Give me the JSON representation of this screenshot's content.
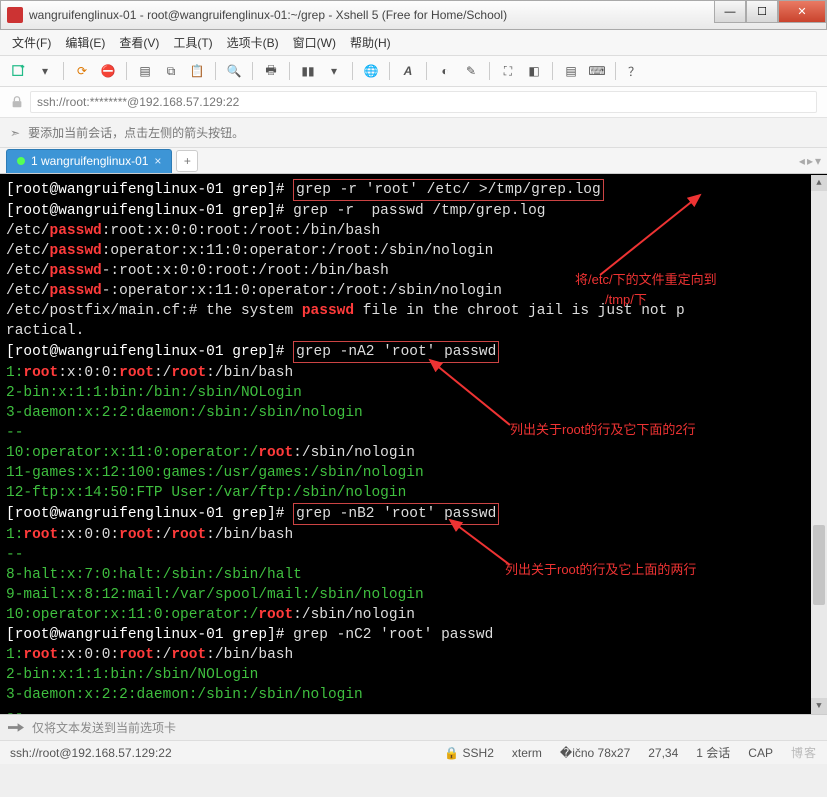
{
  "window": {
    "title": "wangruifenglinux-01 - root@wangruifenglinux-01:~/grep - Xshell 5 (Free for Home/School)"
  },
  "menu": {
    "file": "文件(F)",
    "edit": "编辑(E)",
    "view": "查看(V)",
    "tools": "工具(T)",
    "tabs": "选项卡(B)",
    "window": "窗口(W)",
    "help": "帮助(H)"
  },
  "address": {
    "text": "ssh://root:********@192.168.57.129:22"
  },
  "hint": {
    "text": "要添加当前会话，点击左侧的箭头按钮。"
  },
  "tab": {
    "label": "1 wangruifenglinux-01",
    "close": "×",
    "add": "+"
  },
  "terminal": {
    "prompt": "[root@wangruifenglinux-01 grep]#",
    "cmd1_box": "grep -r 'root' /etc/ >/tmp/grep.log",
    "cmd2": " grep -r  passwd /tmp/grep.log",
    "l1_a": "/etc/",
    "l1_pw": "passwd",
    "l1_b": ":root:x:0:0:root:/root:/bin/bash",
    "l2_a": "/etc/",
    "l2_b": ":operator:x:11:0:operator:/root:/sbin/nologin",
    "l3_a": "/etc/",
    "l3_b": "-:root:x:0:0:root:/root:/bin/bash",
    "l4_a": "/etc/",
    "l4_b": "-:operator:x:11:0:operator:/root:/sbin/nologin",
    "l5_a": "/etc/postfix/main.cf:# the system ",
    "l5_pw": "passwd",
    "l5_b": " file in the chroot jail is just not p",
    "l5_c": "ractical.",
    "cmd3_box": "grep -nA2 'root' passwd",
    "r1_n": "1",
    "r1_a": ":",
    "r1_root": "root",
    "r1_b": ":x:0:0:",
    "r1_c": ":/",
    "r1_d": ":/bin/bash",
    "r2_n": "2",
    "r2_a": "-bin:x:1:1:bin:/bin:/sbin/NOLogin",
    "r3_n": "3",
    "r3_a": "-daemon:x:2:2:daemon:/sbin:/sbin/nologin",
    "dash": "--",
    "r4_n": "10",
    "r4_a": ":operator:x:11:0:operator:/",
    "r4_b": ":/sbin/nologin",
    "r5_n": "11",
    "r5_a": "-games:x:12:100:games:/usr/games:/sbin/nologin",
    "r6_n": "12",
    "r6_a": "-ftp:x:14:50:FTP User:/var/ftp:/sbin/nologin",
    "cmd4_box": "grep -nB2 'root' passwd",
    "b1_n": "1",
    "b1_a": ":",
    "b1_b": ":x:0:0:",
    "b1_c": ":/",
    "b1_d": ":/bin/bash",
    "b2_n": "8",
    "b2_a": "-halt:x:7:0:halt:/sbin:/sbin/halt",
    "b3_n": "9",
    "b3_a": "-mail:x:8:12:mail:/var/spool/mail:/sbin/nologin",
    "b4_n": "10",
    "b4_a": ":operator:x:11:0:operator:/",
    "b4_b": ":/sbin/nologin",
    "cmd5": " grep -nC2 'root' passwd",
    "c1_n": "1",
    "c2_n": "2",
    "c2_a": "-bin:x:1:1:bin:/sbin/NOLogin",
    "c3_n": "3",
    "c3_a": "-daemon:x:2:2:daemon:/sbin:/sbin/nologin"
  },
  "annotations": {
    "a1_l1": "将/etc/下的文件重定向到",
    "a1_l2": "/tmp/下",
    "a2": "列出关于root的行及它下面的2行",
    "a3": "列出关于root的行及它上面的两行"
  },
  "sendbar": {
    "text": "仅将文本发送到当前选项卡"
  },
  "status": {
    "left": "ssh://root@192.168.57.129:22",
    "ssh": "SSH2",
    "term": "xterm",
    "size": "78x27",
    "pos": "27,34",
    "sess": "1 会话",
    "cap": "CAP",
    "wm": "博客"
  }
}
